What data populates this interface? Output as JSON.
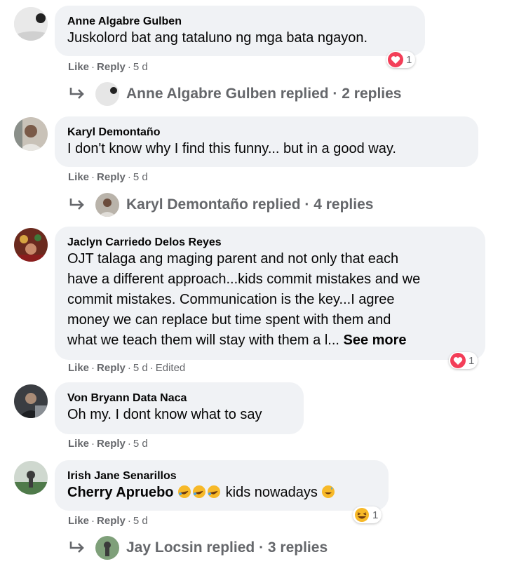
{
  "comments": [
    {
      "author": "Anne Algabre Gulben",
      "text": "Juskolord bat ang tataluno ng mga bata ngayon.",
      "like": "Like",
      "reply": "Reply",
      "time": "5 d",
      "reaction": {
        "type": "heart",
        "count": "1"
      },
      "replies": {
        "summary": "Anne Algabre Gulben replied · 2 replies"
      }
    },
    {
      "author": "Karyl Demontaño",
      "text": "I don't know why I find this funny... but in a good way.",
      "like": "Like",
      "reply": "Reply",
      "time": "5 d",
      "replies": {
        "summary": "Karyl Demontaño replied · 4 replies"
      }
    },
    {
      "author": "Jaclyn Carriedo Delos Reyes",
      "lines": [
        "OJT talaga ang maging parent and not only that each",
        "have a different approach...kids commit mistakes and we",
        "commit mistakes. Communication is the key...I agree",
        "money we can replace but time spent with them and",
        "what we teach them will stay with them a l..."
      ],
      "see_more": "See more",
      "like": "Like",
      "reply": "Reply",
      "time": "5 d",
      "edited": "Edited",
      "reaction": {
        "type": "heart",
        "count": "1"
      }
    },
    {
      "author": "Von Bryann Data Naca",
      "text": "Oh my. I dont know what to say",
      "like": "Like",
      "reply": "Reply",
      "time": "5 d"
    },
    {
      "author": "Irish Jane Senarillos",
      "mention": "Cherry Apruebo",
      "text_after": "kids nowadays",
      "like": "Like",
      "reply": "Reply",
      "time": "5 d",
      "reaction": {
        "type": "haha",
        "count": "1"
      },
      "replies": {
        "summary": "Jay Locsin replied · 3 replies"
      }
    }
  ],
  "colors": {
    "bubble": "#f0f2f5",
    "meta": "#65676b",
    "heart": "#f33e58",
    "text": "#050505"
  },
  "icons": [
    "avatar",
    "reply-arrow-icon",
    "heart-reaction-icon",
    "haha-reaction-icon",
    "rofl-emoji-icon",
    "sweat-smile-emoji-icon"
  ]
}
